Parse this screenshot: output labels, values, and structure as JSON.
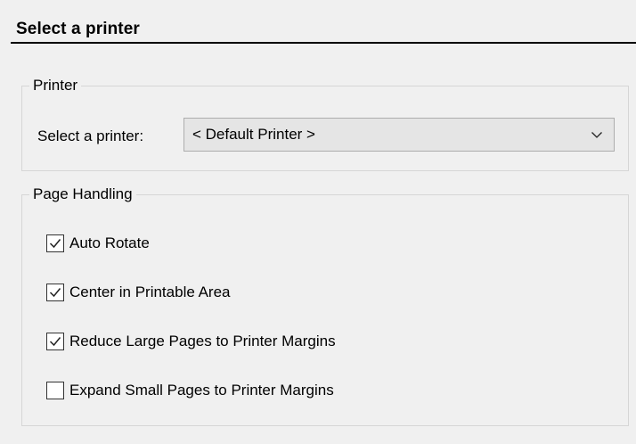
{
  "header": {
    "title": "Select a printer"
  },
  "printer_group": {
    "label": "Printer",
    "select_label": "Select a printer:",
    "selected_value": "< Default Printer >"
  },
  "page_handling": {
    "label": "Page Handling",
    "options": [
      {
        "label": "Auto Rotate",
        "checked": true
      },
      {
        "label": "Center in Printable Area",
        "checked": true
      },
      {
        "label": "Reduce Large Pages to Printer Margins",
        "checked": true
      },
      {
        "label": "Expand Small Pages to Printer Margins",
        "checked": false
      }
    ]
  },
  "icons": {
    "dropdown": "chevron-down-icon",
    "checked": "checkmark-icon"
  }
}
